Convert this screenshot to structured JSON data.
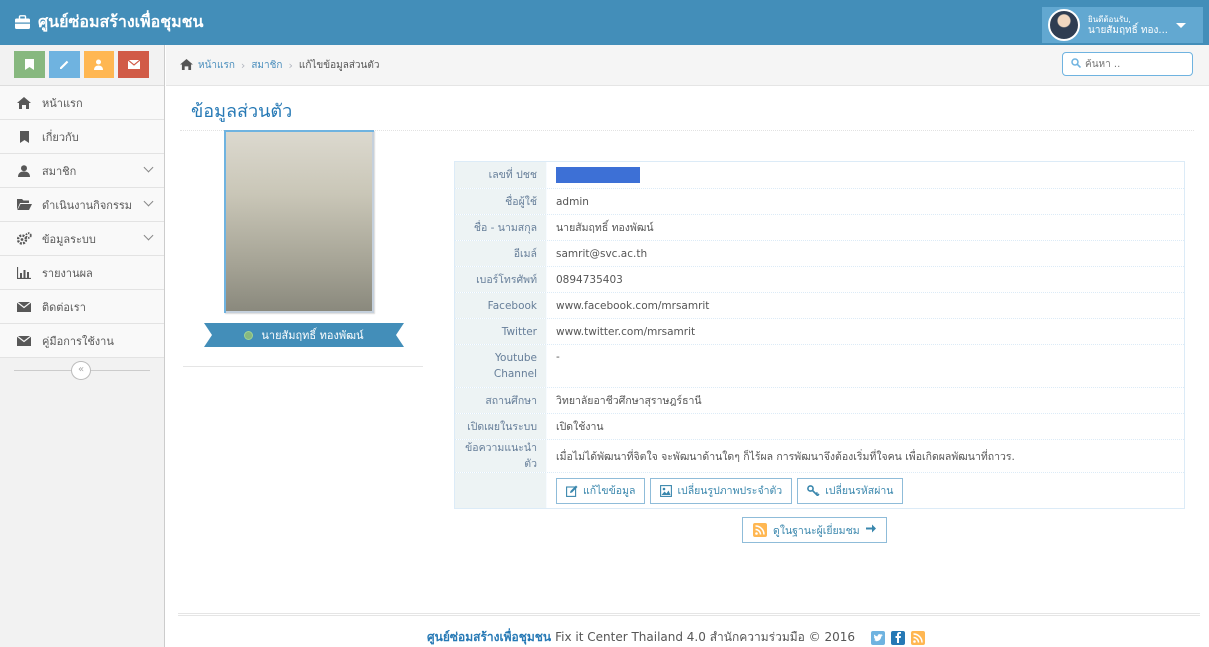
{
  "app": {
    "title": "ศูนย์ซ่อมสร้างเพื่อชุมชน"
  },
  "user": {
    "welcome": "ยินดีต้อนรับ,",
    "name": "นายสัมฤทธิ์ ทอง..."
  },
  "breadcrumb": {
    "home": "หน้าแรก",
    "members": "สมาชิก",
    "current": "แก้ไขข้อมูลส่วนตัว"
  },
  "search": {
    "placeholder": "ค้นหา .."
  },
  "sidebar": {
    "items": [
      {
        "label": "หน้าแรก",
        "icon": "home-icon"
      },
      {
        "label": "เกี่ยวกับ",
        "icon": "bookmark-icon"
      },
      {
        "label": "สมาชิก",
        "icon": "user-icon"
      },
      {
        "label": "ดำเนินงานกิจกรรม",
        "icon": "folder-open-icon"
      },
      {
        "label": "ข้อมูลระบบ",
        "icon": "cogs-icon"
      },
      {
        "label": "รายงานผล",
        "icon": "bar-chart-icon"
      },
      {
        "label": "ติดต่อเรา",
        "icon": "envelope-icon"
      },
      {
        "label": "คู่มือการใช้งาน",
        "icon": "envelope-icon"
      }
    ],
    "collapse_glyph": "«"
  },
  "page": {
    "title": "ข้อมูลส่วนตัว"
  },
  "profile": {
    "display_name": "นายสัมฤทธิ์ ทองพัฒน์",
    "fields": {
      "id_label": "เลขที่ ปชช",
      "username_label": "ชื่อผู้ใช้",
      "username": "admin",
      "fullname_label": "ชื่อ - นามสกุล",
      "fullname": "นายสัมฤทธิ์ ทองพัฒน์",
      "email_label": "อีเมล์",
      "email": "samrit@svc.ac.th",
      "phone_label": "เบอร์โทรศัพท์",
      "phone": "0894735403",
      "facebook_label": "Facebook",
      "facebook": "www.facebook.com/mrsamrit",
      "twitter_label": "Twitter",
      "twitter": "www.twitter.com/mrsamrit",
      "youtube_label": "Youtube Channel",
      "youtube": "-",
      "school_label": "สถานศึกษา",
      "school": "วิทยาลัยอาชีวศึกษาสุราษฎร์ธานี",
      "publish_label": "เปิดเผยในระบบ",
      "publish": "เปิดใช้งาน",
      "intro_label": "ข้อความแนะนำตัว",
      "intro": "เมื่อไม่ได้พัฒนาที่จิตใจ จะพัฒนาด้านใดๆ ก็ไร้ผล การพัฒนาจึงต้องเริ่มที่ใจคน เพื่อเกิดผลพัฒนาที่ถาวร."
    },
    "buttons": {
      "edit": "แก้ไขข้อมูล",
      "change_photo": "เปลี่ยนรูปภาพประจำตัว",
      "change_password": "เปลี่ยนรหัสผ่าน"
    },
    "view_as_visitor": "ดูในฐานะผู้เยี่ยมชม"
  },
  "footer": {
    "brand": "ศูนย์ซ่อมสร้างเพื่อชุมชน",
    "text": "Fix it Center Thailand 4.0 สำนักความร่วมมือ © 2016"
  },
  "colors": {
    "navbar": "#438eb9",
    "accent": "#2679b5",
    "sidebar_bg": "#f2f2f2"
  }
}
